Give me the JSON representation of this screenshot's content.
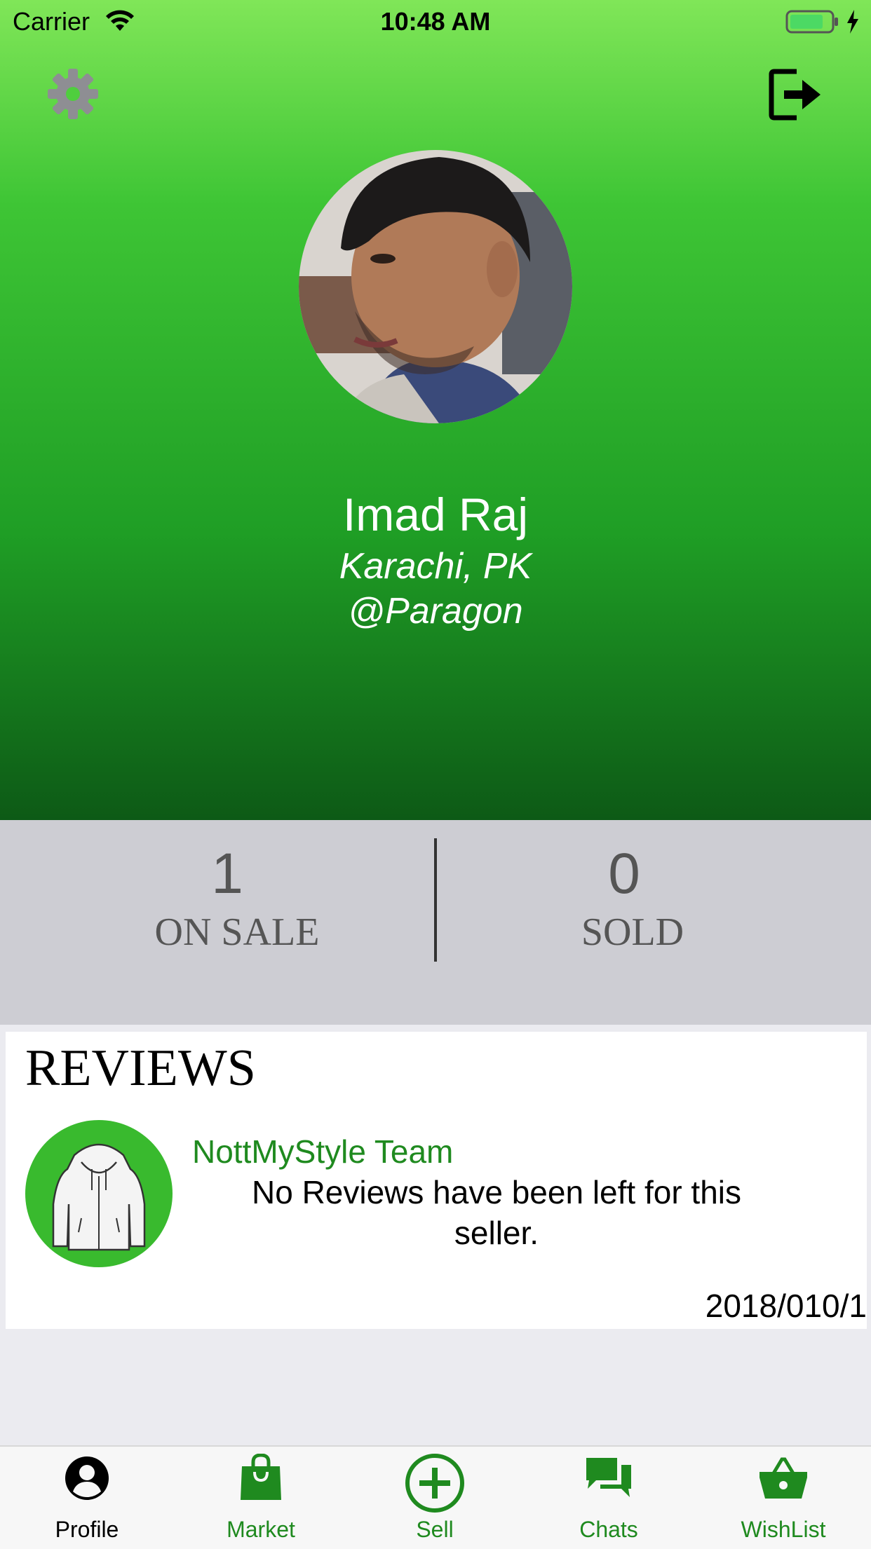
{
  "status_bar": {
    "carrier": "Carrier",
    "time": "10:48 AM"
  },
  "profile": {
    "name": "Imad Raj",
    "location": "Karachi, PK",
    "handle": "@Paragon"
  },
  "stats": {
    "on_sale_value": "1",
    "on_sale_label": "ON SALE",
    "sold_value": "0",
    "sold_label": "SOLD"
  },
  "reviews": {
    "title": "REVIEWS",
    "items": [
      {
        "reviewer": "NottMyStyle Team",
        "text": "No Reviews have been left for this seller.",
        "date": "2018/010/1"
      }
    ]
  },
  "tabs": [
    {
      "label": "Profile",
      "icon": "profile-icon",
      "active": true
    },
    {
      "label": "Market",
      "icon": "shopping-bag-icon",
      "active": false
    },
    {
      "label": "Sell",
      "icon": "plus-circle-icon",
      "active": false
    },
    {
      "label": "Chats",
      "icon": "chat-bubbles-icon",
      "active": false
    },
    {
      "label": "WishList",
      "icon": "basket-icon",
      "active": false
    }
  ],
  "colors": {
    "accent_green": "#1f8a1f",
    "active_tab": "#000000",
    "header_top": "#80e658",
    "header_bottom": "#0d5a16"
  }
}
